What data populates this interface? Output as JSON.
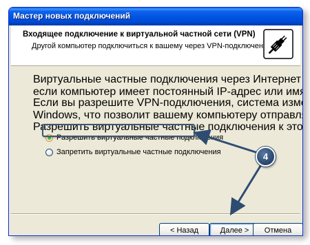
{
  "window": {
    "title": "Мастер новых подключений"
  },
  "header": {
    "title": "Входящее подключение к виртуальной частной сети (VPN)",
    "subtitle": "Другой компьютер подключиться к вашему через VPN-подключение.",
    "icon": "network-plug-icon"
  },
  "content": {
    "paragraph1_line1": "Виртуальные частные подключения через Интернет возможны только в случае,",
    "paragraph1_line2": "если компьютер имеет постоянный IP-адрес или имя в Интернете.",
    "paragraph2_line1": "Если вы разрешите VPN-подключения, система изменит параметры брандмауэра",
    "paragraph2_line2": "Windows, что позволит вашему компьютеру отправлять и получать VPN-пакеты.",
    "question": "Разрешить виртуальные частные подключения к этому компьютеру?",
    "options": [
      {
        "label": "Разрешить виртуальные частные подключения",
        "selected": true
      },
      {
        "label": "Запретить виртуальные частные подключения",
        "selected": false
      }
    ]
  },
  "buttons": {
    "back": "< Назад",
    "next": "Далее >",
    "cancel": "Отмена"
  },
  "callout": {
    "step_number": "4",
    "color": "#2e4c72"
  },
  "colors": {
    "titlebar": "#0054e3",
    "dialog_bg": "#ece9d8",
    "header_bg": "#ffffff"
  }
}
